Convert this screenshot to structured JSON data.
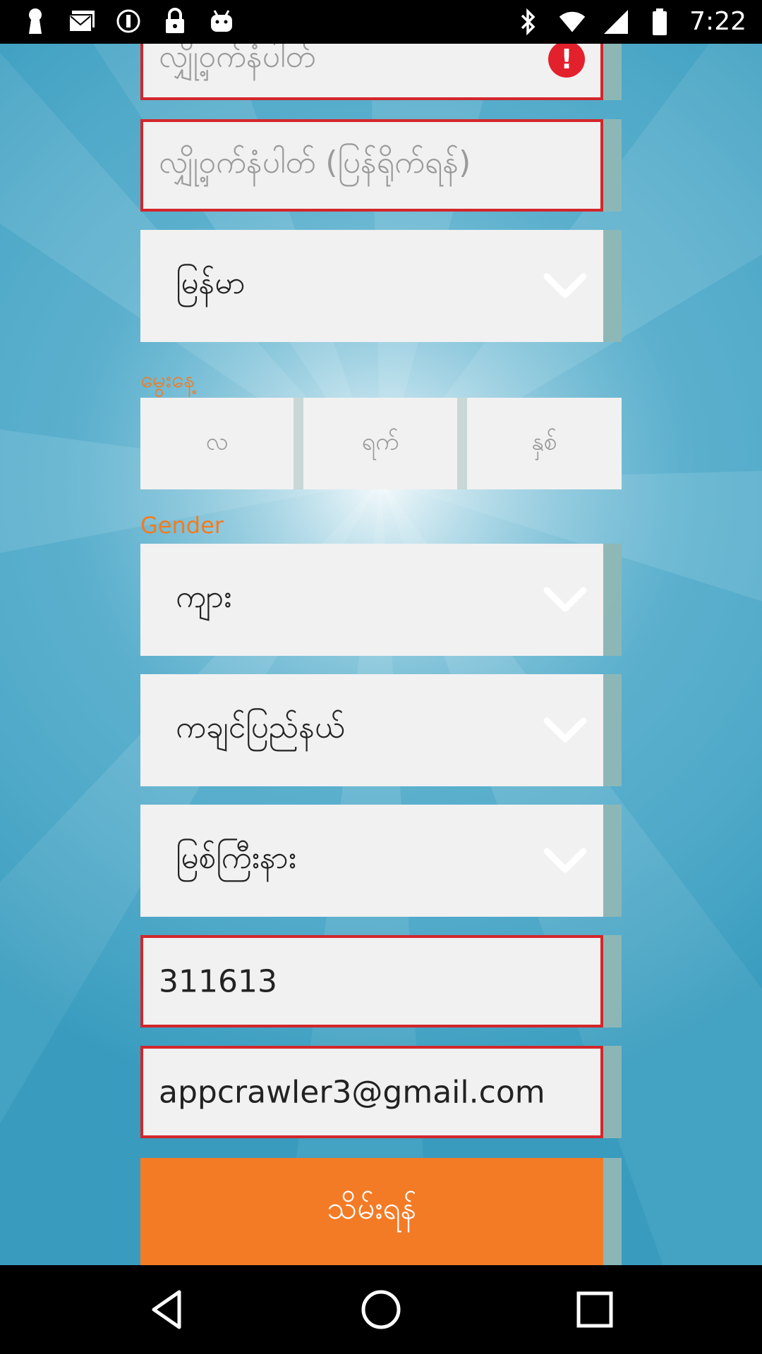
{
  "status_bar": {
    "time": "7:22",
    "left_icons": [
      "keyhole-icon",
      "mail-icon",
      "sync-icon",
      "lock-icon",
      "android-icon"
    ],
    "right_icons": [
      "bluetooth-icon",
      "wifi-icon",
      "signal-icon",
      "battery-icon"
    ]
  },
  "form": {
    "password_field": {
      "placeholder": "လျှို့ဝှက်နံပါတ်",
      "error": true
    },
    "password_confirm_field": {
      "placeholder": "လျှို့ဝှက်နံပါတ် (ပြန်ရိုက်ရန်)",
      "error": true
    },
    "country_select": {
      "value": "မြန်မာ"
    },
    "birthday_label": "မွေးနေ့",
    "birthday": {
      "month_placeholder": "လ",
      "day_placeholder": "ရက်",
      "year_placeholder": "နှစ်"
    },
    "gender_label": "Gender",
    "gender_select": {
      "value": "ကျား"
    },
    "region_select": {
      "value": "ကချင်ပြည်နယ်"
    },
    "city_select": {
      "value": "မြစ်ကြီးနား"
    },
    "code_field": {
      "value": "311613",
      "error": true
    },
    "email_field": {
      "value": "appcrawler3@gmail.com",
      "error": true
    },
    "submit_button": {
      "label": "သိမ်းရန်"
    }
  },
  "colors": {
    "accent_orange": "#f47b20",
    "error_red": "#d3262b",
    "field_bg": "#f1f1f1",
    "background_blue": "#5fb2cf"
  },
  "nav_bar": {
    "buttons": [
      "back-icon",
      "home-icon",
      "recents-icon"
    ]
  }
}
